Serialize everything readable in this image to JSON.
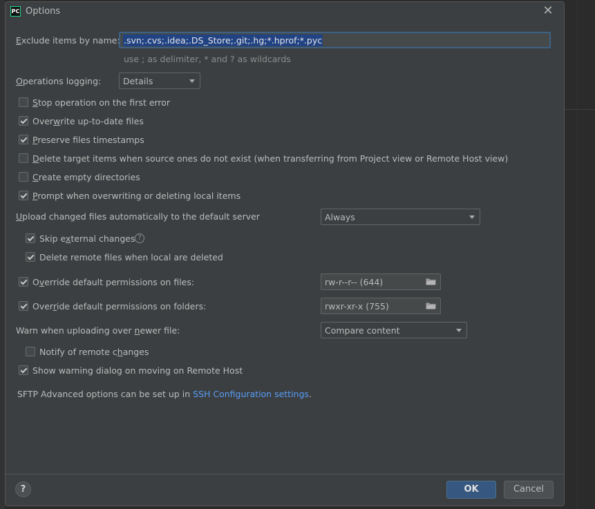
{
  "window": {
    "title": "Options",
    "app_icon": "PC"
  },
  "exclude": {
    "label": "Exclude items by name:",
    "value": ".svn;.cvs;.idea;.DS_Store;.git;.hg;*.hprof;*.pyc",
    "hint": "use ; as delimiter, * and ? as wildcards"
  },
  "operations_logging": {
    "label": "Operations logging:",
    "value": "Details"
  },
  "checkboxes": {
    "stop_first_error": {
      "label": "Stop operation on the first error",
      "checked": false
    },
    "overwrite_uptodate": {
      "label": "Overwrite up-to-date files",
      "checked": true
    },
    "preserve_timestamps": {
      "label": "Preserve files timestamps",
      "checked": true
    },
    "delete_target": {
      "label": "Delete target items when source ones do not exist (when transferring from Project view or Remote Host view)",
      "checked": false
    },
    "create_empty_dirs": {
      "label": "Create empty directories",
      "checked": false
    },
    "prompt_overwrite": {
      "label": "Prompt when overwriting or deleting local items",
      "checked": true
    },
    "skip_external": {
      "label": "Skip external changes",
      "checked": true
    },
    "delete_remote": {
      "label": "Delete remote files when local are deleted",
      "checked": true
    },
    "override_files": {
      "label": "Override default permissions on files:",
      "checked": true
    },
    "override_folders": {
      "label": "Override default permissions on folders:",
      "checked": true
    },
    "notify_remote": {
      "label": "Notify of remote changes",
      "checked": false
    },
    "show_warning": {
      "label": "Show warning dialog on moving on Remote Host",
      "checked": true
    }
  },
  "upload": {
    "label": "Upload changed files automatically to the default server",
    "value": "Always"
  },
  "permissions": {
    "files_value": "rw-r--r-- (644)",
    "folders_value": "rwxr-xr-x (755)"
  },
  "warn_upload": {
    "label": "Warn when uploading over newer file:",
    "value": "Compare content"
  },
  "sftp": {
    "text": "SFTP Advanced options can be set up in ",
    "link": "SSH Configuration settings",
    "suffix": "."
  },
  "buttons": {
    "help": "?",
    "ok": "OK",
    "cancel": "Cancel"
  },
  "colors": {
    "dialog_bg": "#3c3f41",
    "accent": "#365880",
    "link": "#589df6",
    "selection": "#214283"
  }
}
